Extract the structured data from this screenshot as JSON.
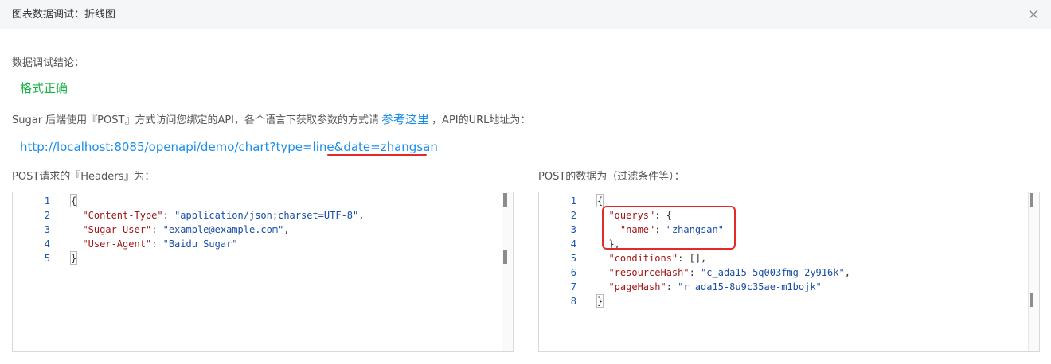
{
  "dialog": {
    "title": "图表数据调试：折线图",
    "close_icon": "close-icon"
  },
  "result": {
    "label": "数据调试结论：",
    "status": "格式正确",
    "status_color": "#19b345"
  },
  "api": {
    "desc_prefix": "Sugar 后端使用『POST』方式访问您绑定的API，各个语言下获取参数的方式请",
    "link_text": "参考这里",
    "desc_suffix": "，API的URL地址为：",
    "url": "http://localhost:8085/openapi/demo/chart?type=line&date=zhangsan"
  },
  "headers_editor": {
    "label": "POST请求的『Headers』为：",
    "lines": [
      {
        "num": "1",
        "parts": [
          {
            "t": "{",
            "c": "p"
          }
        ]
      },
      {
        "num": "2",
        "parts": [
          {
            "t": "  ",
            "c": "p"
          },
          {
            "t": "\"Content-Type\"",
            "c": "k"
          },
          {
            "t": ": ",
            "c": "p"
          },
          {
            "t": "\"application/json;charset=UTF-8\"",
            "c": "s"
          },
          {
            "t": ",",
            "c": "p"
          }
        ]
      },
      {
        "num": "3",
        "parts": [
          {
            "t": "  ",
            "c": "p"
          },
          {
            "t": "\"Sugar-User\"",
            "c": "k"
          },
          {
            "t": ": ",
            "c": "p"
          },
          {
            "t": "\"example@example.com\"",
            "c": "s"
          },
          {
            "t": ",",
            "c": "p"
          }
        ]
      },
      {
        "num": "4",
        "parts": [
          {
            "t": "  ",
            "c": "p"
          },
          {
            "t": "\"User-Agent\"",
            "c": "k"
          },
          {
            "t": ": ",
            "c": "p"
          },
          {
            "t": "\"Baidu Sugar\"",
            "c": "s"
          }
        ]
      },
      {
        "num": "5",
        "parts": [
          {
            "t": "}",
            "c": "p"
          }
        ]
      }
    ]
  },
  "post_editor": {
    "label": "POST的数据为（过滤条件等）：",
    "lines": [
      {
        "num": "1",
        "parts": [
          {
            "t": "{",
            "c": "p"
          }
        ]
      },
      {
        "num": "2",
        "parts": [
          {
            "t": "  ",
            "c": "p"
          },
          {
            "t": "\"querys\"",
            "c": "k"
          },
          {
            "t": ": {",
            "c": "p"
          }
        ]
      },
      {
        "num": "3",
        "parts": [
          {
            "t": "    ",
            "c": "p"
          },
          {
            "t": "\"name\"",
            "c": "k"
          },
          {
            "t": ": ",
            "c": "p"
          },
          {
            "t": "\"zhangsan\"",
            "c": "s"
          }
        ]
      },
      {
        "num": "4",
        "parts": [
          {
            "t": "  },",
            "c": "p"
          }
        ]
      },
      {
        "num": "5",
        "parts": [
          {
            "t": "  ",
            "c": "p"
          },
          {
            "t": "\"conditions\"",
            "c": "k"
          },
          {
            "t": ": [],",
            "c": "p"
          }
        ]
      },
      {
        "num": "6",
        "parts": [
          {
            "t": "  ",
            "c": "p"
          },
          {
            "t": "\"resourceHash\"",
            "c": "k"
          },
          {
            "t": ": ",
            "c": "p"
          },
          {
            "t": "\"c_ada15-5q003fmg-2y916k\"",
            "c": "s"
          },
          {
            "t": ",",
            "c": "p"
          }
        ]
      },
      {
        "num": "7",
        "parts": [
          {
            "t": "  ",
            "c": "p"
          },
          {
            "t": "\"pageHash\"",
            "c": "k"
          },
          {
            "t": ": ",
            "c": "p"
          },
          {
            "t": "\"r_ada15-8u9c35ae-m1bojk\"",
            "c": "s"
          }
        ]
      },
      {
        "num": "8",
        "parts": [
          {
            "t": "}",
            "c": "p"
          }
        ]
      }
    ]
  }
}
